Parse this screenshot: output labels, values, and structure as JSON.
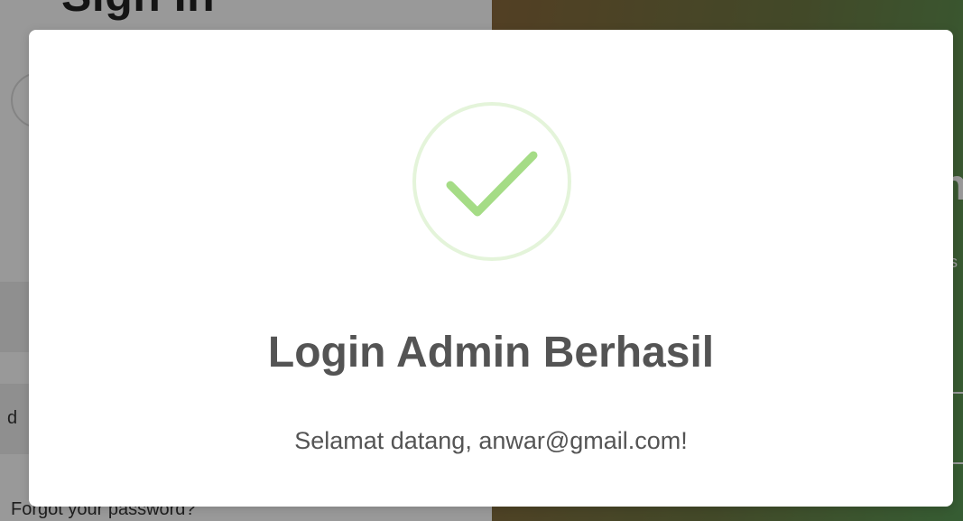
{
  "login_page": {
    "title": "Sign In",
    "password_label": "d",
    "forgot_password": "Forgot your password?",
    "right_heading": "n",
    "right_text": "s"
  },
  "modal": {
    "icon": "success-check-icon",
    "title": "Login Admin Berhasil",
    "message": "Selamat datang, anwar@gmail.com!",
    "colors": {
      "check": "#a5dc86",
      "ring": "rgba(165, 220, 134, 0.3)",
      "text": "#545454"
    }
  }
}
